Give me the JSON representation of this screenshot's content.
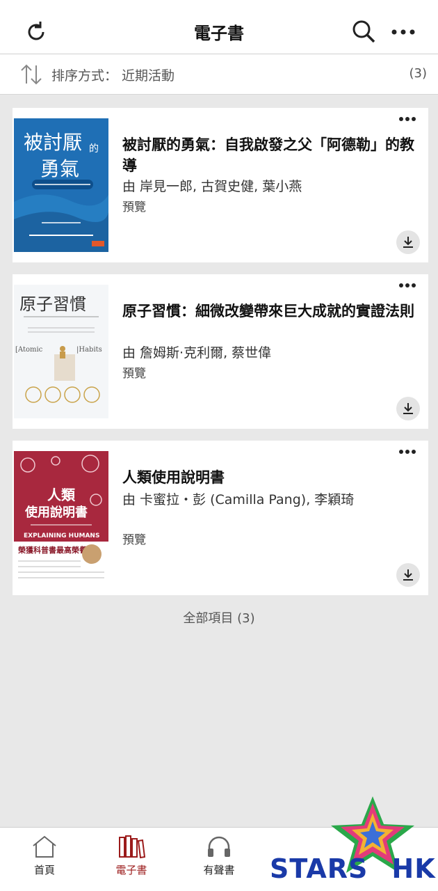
{
  "header": {
    "title": "電子書",
    "icons": [
      "refresh-icon",
      "search-icon",
      "more-icon"
    ]
  },
  "sort": {
    "label": "排序方式： 近期活動",
    "count": "(3)"
  },
  "books": [
    {
      "title": "被討厭的勇氣：自我啟發之父「阿德勒」的教導",
      "author": "由 岸見一郎, 古賀史健, 葉小燕",
      "preview": "預覽",
      "cover": {
        "main": "被討厭的勇氣",
        "sub": "自我啟發之父「阿德勒」的教導",
        "bg": "#1f6fb5"
      }
    },
    {
      "title": "原子習慣：細微改變帶來巨大成就的實證法則",
      "author": "由 詹姆斯·克利爾, 蔡世偉",
      "preview": "預覽",
      "cover": {
        "main": "原子習慣",
        "sub": "細微改變帶來巨大成就的實證法則",
        "en1": "Atomic",
        "en2": "Habits",
        "bg": "#f4f6f8"
      }
    },
    {
      "title": "人類使用說明書",
      "author": "由 卡蜜拉・彭 (Camilla Pang), 李穎琦",
      "preview": "預覽",
      "cover": {
        "main1": "人類",
        "main2": "使用說明書",
        "en": "EXPLAINING HUMANS",
        "badge": "榮獲科普書最高榮譽",
        "bg": "#a8283e"
      }
    }
  ],
  "footer": {
    "all_items": "全部項目 (3)"
  },
  "tabs": [
    {
      "label": "首頁",
      "icon": "home-icon"
    },
    {
      "label": "電子書",
      "icon": "books-icon",
      "active": true
    },
    {
      "label": "有聲書",
      "icon": "headphones-icon"
    }
  ],
  "watermark": {
    "text1": "STARS",
    "text2": "HK"
  },
  "colors": {
    "accent": "#9b1b1b",
    "background": "#e8e8e8"
  }
}
